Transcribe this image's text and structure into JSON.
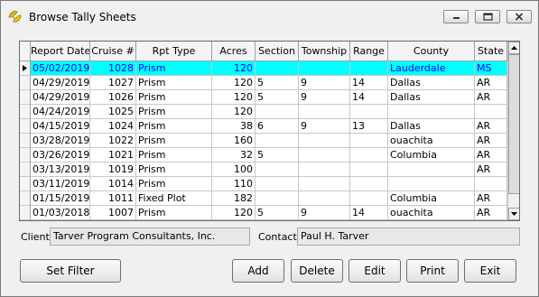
{
  "window": {
    "title": "Browse Tally Sheets"
  },
  "grid": {
    "columns": [
      "Report Date",
      "Cruise #",
      "Rpt Type",
      "Acres",
      "Section",
      "Township",
      "Range",
      "County",
      "State"
    ],
    "rows": [
      [
        "05/02/2019",
        "1028",
        "Prism",
        "120",
        "",
        "",
        "",
        "Lauderdale",
        "MS"
      ],
      [
        "04/29/2019",
        "1027",
        "Prism",
        "120",
        "5",
        "9",
        "14",
        "Dallas",
        "AR"
      ],
      [
        "04/29/2019",
        "1026",
        "Prism",
        "120",
        "5",
        "9",
        "14",
        "Dallas",
        "AR"
      ],
      [
        "04/24/2019",
        "1025",
        "Prism",
        "120",
        "",
        "",
        "",
        "",
        ""
      ],
      [
        "04/15/2019",
        "1024",
        "Prism",
        "38",
        "6",
        "9",
        "13",
        "Dallas",
        "AR"
      ],
      [
        "03/28/2019",
        "1022",
        "Prism",
        "160",
        "",
        "",
        "",
        "ouachita",
        "AR"
      ],
      [
        "03/26/2019",
        "1021",
        "Prism",
        "32",
        "5",
        "",
        "",
        "Columbia",
        "AR"
      ],
      [
        "03/13/2019",
        "1019",
        "Prism",
        "100",
        "",
        "",
        "",
        "",
        "AR"
      ],
      [
        "03/11/2019",
        "1014",
        "Prism",
        "110",
        "",
        "",
        "",
        "",
        ""
      ],
      [
        "01/15/2019",
        "1011",
        "Fixed Plot",
        "182",
        "",
        "",
        "",
        "Columbia",
        "AR"
      ],
      [
        "01/03/2018",
        "1007",
        "Prism",
        "120",
        "5",
        "9",
        "14",
        "ouachita",
        "AR"
      ]
    ],
    "selected_row": 0
  },
  "client": {
    "label": "Client:",
    "value": "Tarver Program Consultants, Inc."
  },
  "contact": {
    "label": "Contact:",
    "value": "Paul H. Tarver"
  },
  "buttons": {
    "set_filter": "Set Filter",
    "add": "Add",
    "delete": "Delete",
    "edit": "Edit",
    "print": "Print",
    "exit": "Exit"
  },
  "colors": {
    "selection_bg": "#00ffff",
    "selection_text": "#0000ff"
  }
}
